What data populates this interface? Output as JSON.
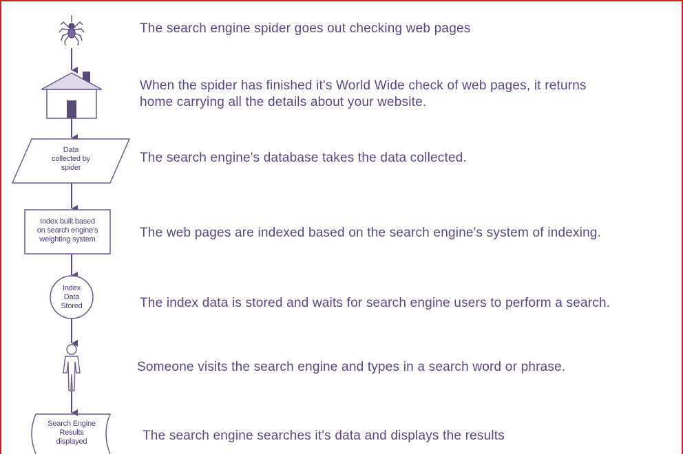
{
  "colors": {
    "border": "#cc2222",
    "ink": "#5b4586",
    "shape_stroke": "#6a5a8e",
    "house_fill": "#ddd8ea",
    "accent": "#5a4a7a"
  },
  "icons": [
    "spider-icon",
    "house-icon",
    "person-icon"
  ],
  "steps": [
    {
      "text": "The search engine spider goes out checking web pages"
    },
    {
      "lines": [
        "When the spider has finished it's World Wide check of web pages, it returns",
        "home carrying all the details about your website."
      ]
    },
    {
      "text": "The search engine's database takes the data collected."
    },
    {
      "text": "The web pages are indexed based on the search engine's system of indexing."
    },
    {
      "text": "The index data is stored and waits for search engine users to perform a search."
    },
    {
      "text": "Someone visits the search engine and types in a search word or phrase."
    },
    {
      "text": "The search engine searches it's data and displays the results"
    }
  ],
  "shapes": {
    "data_parallelogram": {
      "lines": [
        "Data",
        "collected by",
        "spider"
      ]
    },
    "index_box": {
      "lines": [
        "Index built based",
        "on search engine's",
        "weighting system"
      ]
    },
    "stored_circle": {
      "lines": [
        "Index",
        "Data",
        "Stored"
      ]
    },
    "results_display": {
      "lines": [
        "Search Engine",
        "Results",
        "displayed"
      ]
    }
  }
}
